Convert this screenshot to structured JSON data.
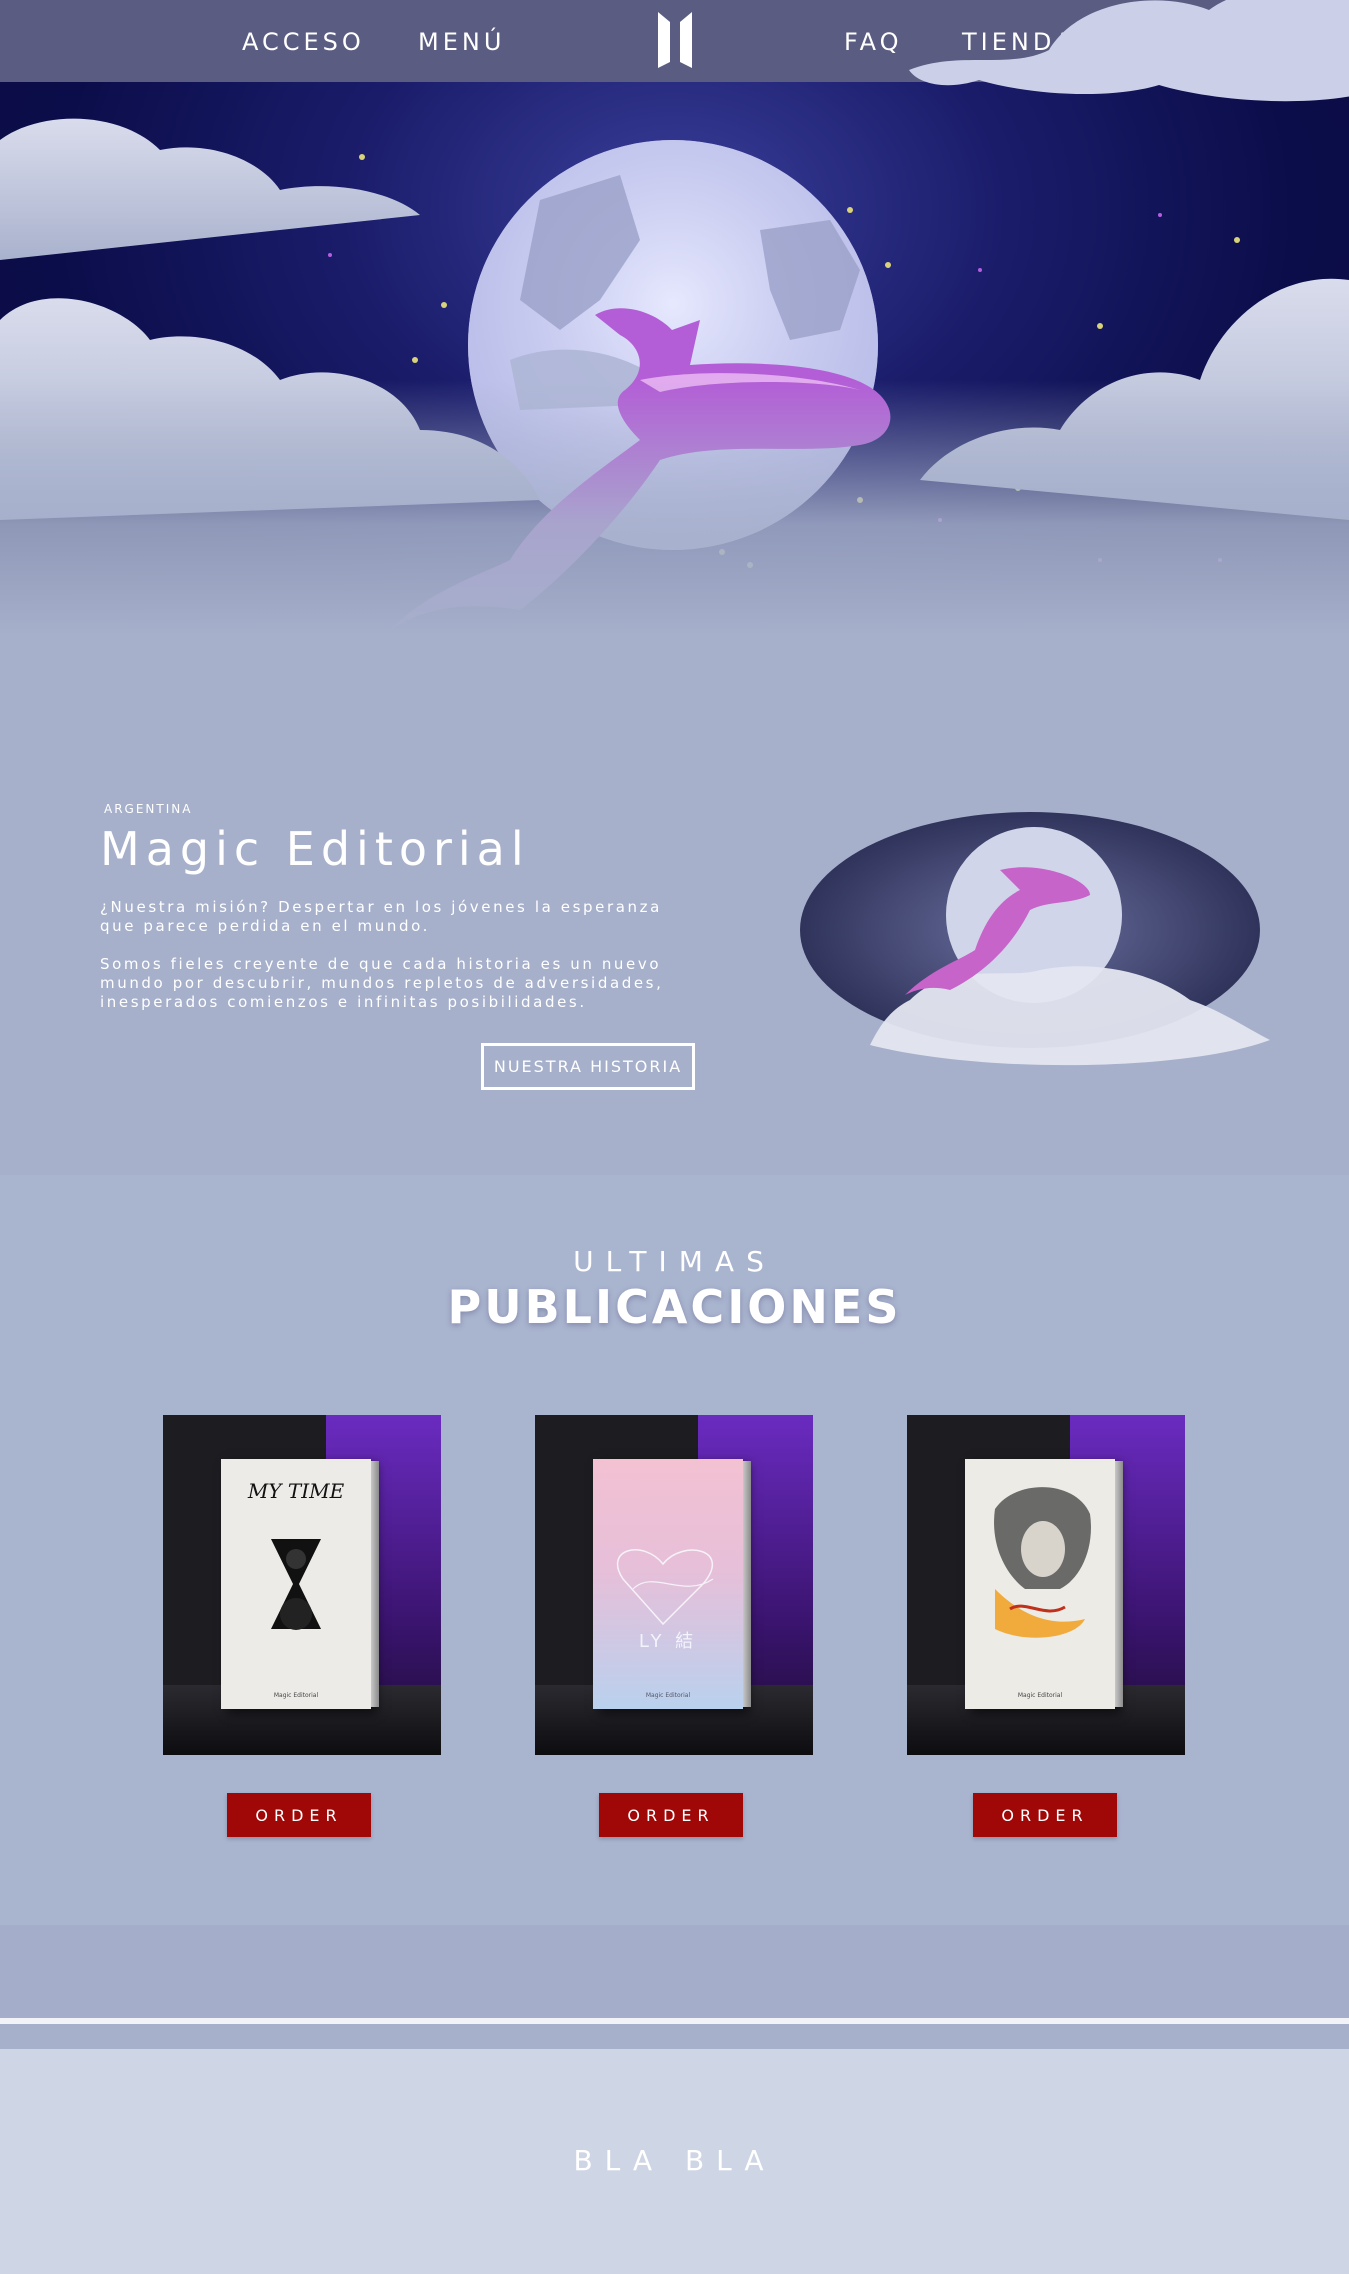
{
  "nav": {
    "left": [
      "ACCESO",
      "MENÚ"
    ],
    "right": [
      "FAQ",
      "TIENDA"
    ]
  },
  "about": {
    "eyebrow": "ARGENTINA",
    "title": "Magic Editorial",
    "paragraph1": "¿Nuestra misión? Despertar en los jóvenes la esperanza que parece perdida en el mundo.",
    "paragraph2": "Somos fieles creyente de que cada historia es un nuevo mundo por descubrir, mundos repletos de adversidades, inesperados comienzos e infinitas posibilidades.",
    "button": "NUESTRA HISTORIA"
  },
  "publications": {
    "eyebrow": "ULTIMAS",
    "title": "PUBLICACIONES",
    "books": [
      {
        "cover_title": "MY TIME",
        "order": "ORDER"
      },
      {
        "cover_title": "LY 結",
        "order": "ORDER"
      },
      {
        "cover_title": "",
        "order": "ORDER"
      }
    ],
    "publisher_mark": "Magic Editorial"
  },
  "footer": {
    "text": "BLA BLA"
  },
  "colors": {
    "topbar": "#5a5c82",
    "sky": "#0b0d4a",
    "page": "#a6b0cb",
    "whale": "#b25fd8",
    "order": "#a00808",
    "footer": "#ced5e4"
  }
}
